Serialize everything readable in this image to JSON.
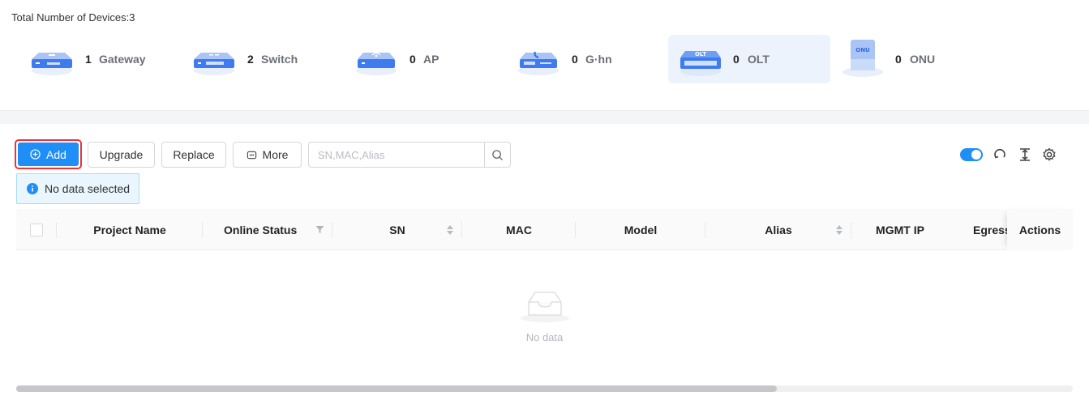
{
  "summary": {
    "total_label": "Total Number of Devices:3",
    "devices": [
      {
        "count": "1",
        "label": "Gateway",
        "icon": "gateway-icon"
      },
      {
        "count": "2",
        "label": "Switch",
        "icon": "switch-icon"
      },
      {
        "count": "0",
        "label": "AP",
        "icon": "ap-icon"
      },
      {
        "count": "0",
        "label": "G·hn",
        "icon": "ghn-icon"
      },
      {
        "count": "0",
        "label": "OLT",
        "icon": "olt-icon",
        "icon_text": "OLT",
        "active": true
      },
      {
        "count": "0",
        "label": "ONU",
        "icon": "onu-icon",
        "icon_text": "ONU"
      }
    ]
  },
  "toolbar": {
    "add_label": "Add",
    "upgrade_label": "Upgrade",
    "replace_label": "Replace",
    "more_label": "More",
    "search_placeholder": "SN,MAC,Alias",
    "toggle_on": true
  },
  "notice": {
    "text": "No data selected"
  },
  "table": {
    "columns": [
      "Project Name",
      "Online Status",
      "SN",
      "MAC",
      "Model",
      "Alias",
      "MGMT IP",
      "Egress"
    ],
    "actions_label": "Actions",
    "empty_text": "No data"
  },
  "colors": {
    "primary": "#1f8ef7",
    "highlight": "#e8343b",
    "active_card": "#edf3fd"
  }
}
